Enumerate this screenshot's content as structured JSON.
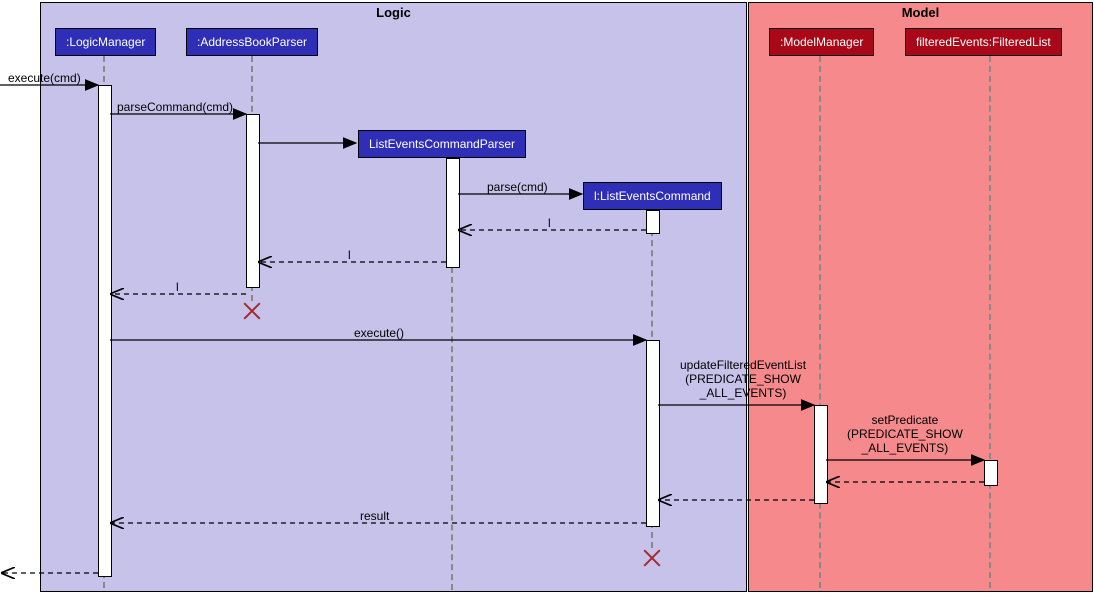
{
  "packages": {
    "logic": "Logic",
    "model": "Model"
  },
  "lifelines": {
    "logicManager": ":LogicManager",
    "addressBookParser": ":AddressBookParser",
    "listEventsCommandParser": "ListEventsCommandParser",
    "listEventsCommand": "l:ListEventsCommand",
    "modelManager": ":ModelManager",
    "filteredList": "filteredEvents:FilteredList"
  },
  "messages": {
    "executeCmd": "execute(cmd)",
    "parseCommand": "parseCommand(cmd)",
    "parseCmd": "parse(cmd)",
    "returnL1": "l",
    "returnL2": "l",
    "returnL3": "l",
    "executeCall": "execute()",
    "updateFilteredEventList": "updateFilteredEventList\n(PREDICATE_SHOW\n_ALL_EVENTS)",
    "setPredicate": "setPredicate\n(PREDICATE_SHOW\n_ALL_EVENTS)",
    "result": "result"
  },
  "colors": {
    "logicBg": "#c7c2ea",
    "modelBg": "#f5898c",
    "blueHead": "#2f2eb7",
    "redHead": "#a90818",
    "destroy": "#a52a2a"
  },
  "chart_data": {
    "type": "sequence-diagram",
    "packages": [
      {
        "name": "Logic",
        "lifelines": [
          "LogicManager",
          "AddressBookParser",
          "ListEventsCommandParser",
          "ListEventsCommand"
        ]
      },
      {
        "name": "Model",
        "lifelines": [
          "ModelManager",
          "filteredEvents:FilteredList"
        ]
      }
    ],
    "lifelines": [
      "LogicManager",
      "AddressBookParser",
      "ListEventsCommandParser",
      "ListEventsCommand",
      "ModelManager",
      "filteredEvents:FilteredList"
    ],
    "messages": [
      {
        "from": "external",
        "to": "LogicManager",
        "label": "execute(cmd)",
        "kind": "sync"
      },
      {
        "from": "LogicManager",
        "to": "AddressBookParser",
        "label": "parseCommand(cmd)",
        "kind": "sync"
      },
      {
        "from": "AddressBookParser",
        "to": "ListEventsCommandParser",
        "label": "",
        "kind": "create"
      },
      {
        "from": "ListEventsCommandParser",
        "to": "ListEventsCommand",
        "label": "parse(cmd)",
        "kind": "create"
      },
      {
        "from": "ListEventsCommand",
        "to": "ListEventsCommandParser",
        "label": "l",
        "kind": "return"
      },
      {
        "from": "ListEventsCommandParser",
        "to": "AddressBookParser",
        "label": "l",
        "kind": "return"
      },
      {
        "from": "AddressBookParser",
        "to": "LogicManager",
        "label": "l",
        "kind": "return"
      },
      {
        "from": "LogicManager",
        "to": "ListEventsCommand",
        "label": "execute()",
        "kind": "sync"
      },
      {
        "from": "ListEventsCommand",
        "to": "ModelManager",
        "label": "updateFilteredEventList(PREDICATE_SHOW_ALL_EVENTS)",
        "kind": "sync"
      },
      {
        "from": "ModelManager",
        "to": "filteredEvents:FilteredList",
        "label": "setPredicate(PREDICATE_SHOW_ALL_EVENTS)",
        "kind": "sync"
      },
      {
        "from": "filteredEvents:FilteredList",
        "to": "ModelManager",
        "label": "",
        "kind": "return"
      },
      {
        "from": "ModelManager",
        "to": "ListEventsCommand",
        "label": "",
        "kind": "return"
      },
      {
        "from": "ListEventsCommand",
        "to": "LogicManager",
        "label": "result",
        "kind": "return"
      },
      {
        "from": "LogicManager",
        "to": "external",
        "label": "",
        "kind": "return"
      }
    ],
    "destroyed": [
      "AddressBookParser",
      "ListEventsCommand"
    ]
  }
}
